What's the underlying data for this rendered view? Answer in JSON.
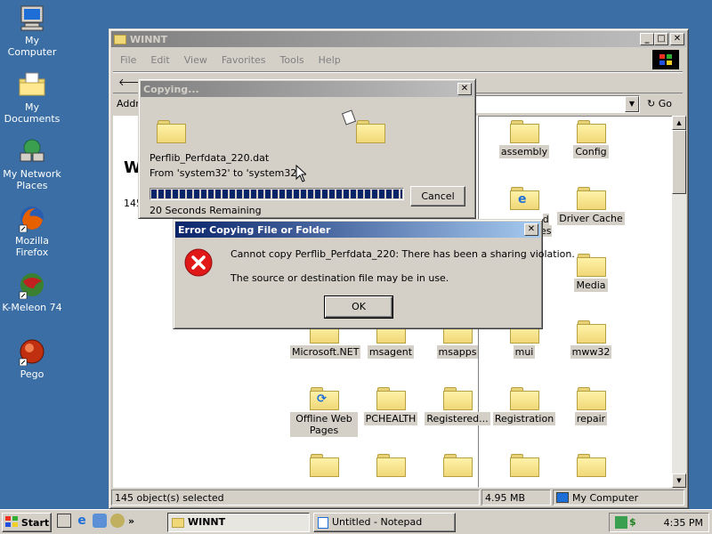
{
  "desktop": {
    "icons": [
      {
        "label": "My Computer",
        "icon": "my-computer-icon"
      },
      {
        "label": "My Documents",
        "icon": "my-documents-icon"
      },
      {
        "label": "My Network Places",
        "icon": "network-places-icon"
      },
      {
        "label": "Mozilla Firefox",
        "icon": "firefox-icon"
      },
      {
        "label": "K-Meleon 74",
        "icon": "kmeleon-icon"
      },
      {
        "label": "Pego",
        "icon": "pego-icon"
      }
    ]
  },
  "explorer": {
    "title": "WINNT",
    "menu": [
      "File",
      "Edit",
      "View",
      "Favorites",
      "Tools",
      "Help"
    ],
    "address_label": "Addre",
    "back_label": "B",
    "go_label": "Go",
    "left_panel_title": "W",
    "left_panel_count": "145",
    "folders": [
      {
        "label": "assembly",
        "icon": "folder-icon"
      },
      {
        "label": "Config",
        "icon": "folder-icon"
      },
      {
        "label": "d",
        "label2": "es",
        "icon": "ie-folder-icon"
      },
      {
        "label": "Driver Cache",
        "icon": "folder-icon"
      },
      {
        "label": "Media",
        "icon": "folder-icon"
      },
      {
        "label": "Microsoft.NET",
        "icon": "folder-icon"
      },
      {
        "label": "msagent",
        "icon": "folder-icon"
      },
      {
        "label": "msapps",
        "icon": "folder-icon"
      },
      {
        "label": "mui",
        "icon": "folder-icon"
      },
      {
        "label": "mww32",
        "icon": "folder-icon"
      },
      {
        "label": "Offline Web Pages",
        "icon": "offline-folder-icon"
      },
      {
        "label": "PCHEALTH",
        "icon": "folder-icon"
      },
      {
        "label": "Registered...",
        "icon": "folder-icon"
      },
      {
        "label": "Registration",
        "icon": "folder-icon"
      },
      {
        "label": "repair",
        "icon": "folder-icon"
      }
    ],
    "status": {
      "selected": "145 object(s) selected",
      "size": "4.95 MB",
      "zone": "My Computer"
    }
  },
  "copying": {
    "title": "Copying...",
    "filename": "Perflib_Perfdata_220.dat",
    "from_to": "From 'system32' to 'system32'",
    "remaining": "20 Seconds Remaining",
    "cancel_label": "Cancel",
    "progress": 1.0
  },
  "error": {
    "title": "Error Copying File or Folder",
    "message": "Cannot copy Perflib_Perfdata_220: There has been a sharing violation.",
    "detail": "The source or destination file may be in use.",
    "ok_label": "OK"
  },
  "taskbar": {
    "start_label": "Start",
    "tasks": [
      {
        "label": "WINNT",
        "active": true
      },
      {
        "label": "Untitled - Notepad",
        "active": false
      }
    ],
    "time": "4:35 PM"
  },
  "colors": {
    "desktop": "#3a6ea5",
    "title_active": "#0a246a",
    "face": "#d4d0c8",
    "progress": "#0a246a"
  }
}
